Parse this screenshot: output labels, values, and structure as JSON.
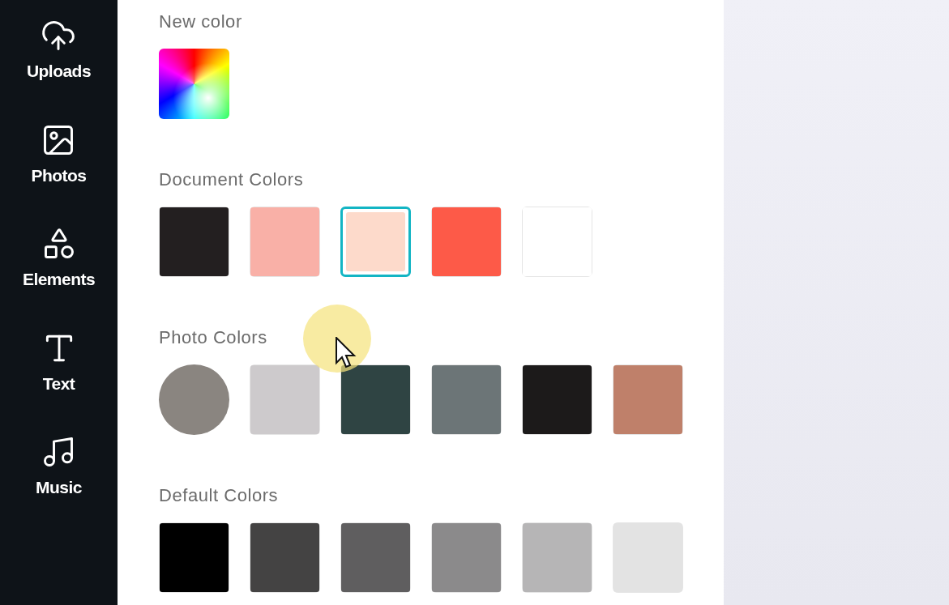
{
  "sidebar": {
    "items": [
      {
        "label": "Uploads",
        "kind": "upload"
      },
      {
        "label": "Photos",
        "kind": "photo"
      },
      {
        "label": "Elements",
        "kind": "elements"
      },
      {
        "label": "Text",
        "kind": "text"
      },
      {
        "label": "Music",
        "kind": "music"
      }
    ]
  },
  "sections": [
    {
      "title": "New color",
      "swatches": [
        {
          "kind": "picker"
        }
      ]
    },
    {
      "title": "Document Colors",
      "swatches": [
        {
          "kind": "color",
          "color": "#231f20",
          "selected": false
        },
        {
          "kind": "color",
          "color": "#f9b0a7",
          "selected": false
        },
        {
          "kind": "color",
          "color": "#fddacb",
          "selected": true
        },
        {
          "kind": "color",
          "color": "#fd5a48",
          "selected": false
        },
        {
          "kind": "color",
          "color": "#ffffff",
          "selected": false
        }
      ]
    },
    {
      "title": "Photo Colors",
      "swatches": [
        {
          "kind": "photo"
        },
        {
          "kind": "color",
          "color": "#cdcacc"
        },
        {
          "kind": "color",
          "color": "#2f4443"
        },
        {
          "kind": "color",
          "color": "#6c7577"
        },
        {
          "kind": "color",
          "color": "#1c1a1a"
        },
        {
          "kind": "color",
          "color": "#bf806a"
        }
      ]
    },
    {
      "title": "Default Colors",
      "swatches": [
        {
          "kind": "color",
          "color": "#000000"
        },
        {
          "kind": "color",
          "color": "#444343"
        },
        {
          "kind": "color",
          "color": "#5f5e5f"
        },
        {
          "kind": "color",
          "color": "#8b8a8b"
        },
        {
          "kind": "color",
          "color": "#b6b5b6"
        },
        {
          "kind": "color",
          "color": "#e3e3e3"
        }
      ]
    }
  ]
}
